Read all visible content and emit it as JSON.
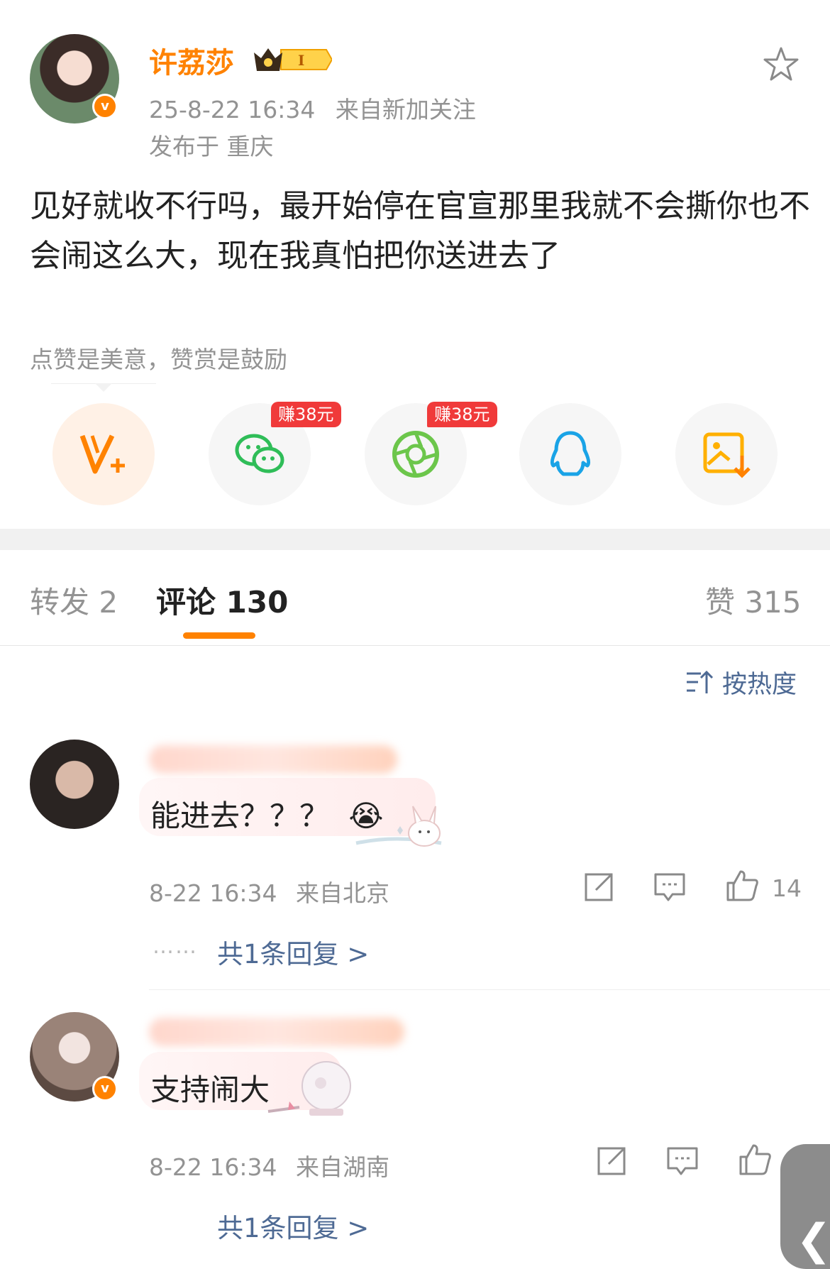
{
  "post": {
    "author": "许荔莎",
    "level_badge": "I",
    "time": "25-8-22 16:34",
    "source": "来自新加关注",
    "location": "发布于 重庆",
    "content": "见好就收不行吗，最开始停在官宣那里我就不会撕你也不会闹这么大，现在我真怕把你送进去了",
    "reward_text": "点赞是美意，赞赏是鼓励",
    "favorite_icon": "star-outline-icon"
  },
  "share_buttons": [
    {
      "icon": "v-plus-icon",
      "name": "reward"
    },
    {
      "icon": "wechat-icon",
      "name": "wechat",
      "badge": "赚38元"
    },
    {
      "icon": "moments-icon",
      "name": "moments",
      "badge": "赚38元"
    },
    {
      "icon": "qq-icon",
      "name": "qq"
    },
    {
      "icon": "save-image-icon",
      "name": "save-image"
    }
  ],
  "tabs": {
    "repost": "转发 2",
    "comments": "评论 130",
    "likes": "赞 315"
  },
  "sort": {
    "label": "按热度",
    "icon": "sort-icon"
  },
  "comments": [
    {
      "text": "能进去？？？",
      "emoji": "😭",
      "time": "8-22 16:34",
      "source": "来自北京",
      "likes": "14",
      "dots": "……",
      "replies": "共1条回复 >"
    },
    {
      "text": "支持闹大",
      "time": "8-22 16:34",
      "source": "来自湖南",
      "likes": "",
      "replies": "共1条回复 >"
    }
  ],
  "colors": {
    "brand_orange": "#ff8200",
    "link_blue": "#4e6a94",
    "badge_red": "#f03a3a",
    "wechat_green": "#2fbd58",
    "moments_green": "#6cc64b",
    "qq_blue": "#1aa3e6"
  },
  "back_glyph": "❮"
}
